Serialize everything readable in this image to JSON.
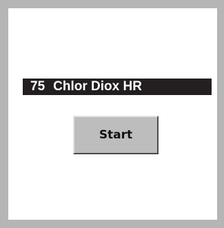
{
  "program": {
    "number": "75",
    "name": "Chlor Diox HR"
  },
  "actions": {
    "start_label": "Start"
  }
}
